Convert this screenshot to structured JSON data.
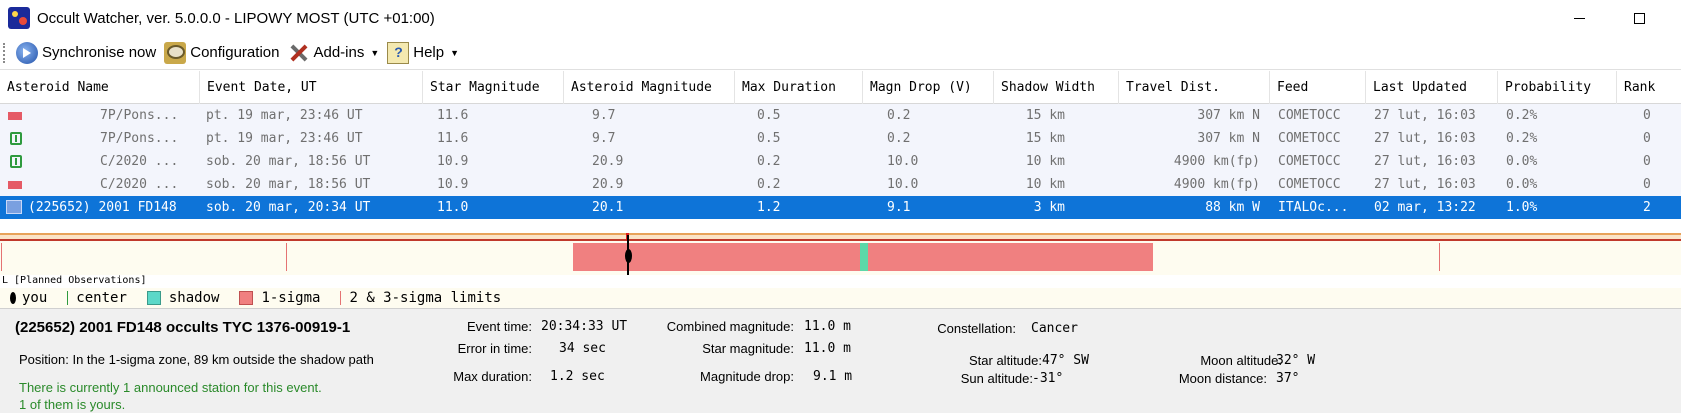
{
  "window": {
    "title": "Occult Watcher, ver. 5.0.0.0 - LIPOWY MOST (UTC +01:00)"
  },
  "toolbar": {
    "sync_label": "Synchronise now",
    "config_label": "Configuration",
    "addins_label": "Add-ins",
    "help_label": "Help"
  },
  "table": {
    "columns": [
      "Asteroid Name",
      "Event Date, UT",
      "Star Magnitude",
      "Asteroid Magnitude",
      "Max Duration",
      "Magn Drop (V)",
      "Shadow Width",
      "Travel Dist.",
      "Feed",
      "Last Updated",
      "Probability",
      "Rank"
    ],
    "rows": [
      {
        "icon": "flag-icon",
        "name": "7P/Pons...",
        "date": "pt. 19 mar, 23:46 UT",
        "star_mag": "11.6",
        "ast_mag": "9.7",
        "max_dur": "0.5",
        "magn_drop": "0.2",
        "shadow_width": "15 km",
        "travel": "307 km N",
        "feed": "COMETOCC",
        "updated": "27 lut, 16:03",
        "prob": "0.2%",
        "rank": "0"
      },
      {
        "icon": "station-icon",
        "name": "7P/Pons...",
        "date": "pt. 19 mar, 23:46 UT",
        "star_mag": "11.6",
        "ast_mag": "9.7",
        "max_dur": "0.5",
        "magn_drop": "0.2",
        "shadow_width": "15 km",
        "travel": "307 km N",
        "feed": "COMETOCC",
        "updated": "27 lut, 16:03",
        "prob": "0.2%",
        "rank": "0"
      },
      {
        "icon": "station-icon",
        "name": "C/2020 ...",
        "date": "sob. 20 mar, 18:56 UT",
        "star_mag": "10.9",
        "ast_mag": "20.9",
        "max_dur": "0.2",
        "magn_drop": "10.0",
        "shadow_width": "10 km",
        "travel": "4900 km(fp)",
        "feed": "COMETOCC",
        "updated": "27 lut, 16:03",
        "prob": "0.0%",
        "rank": "0"
      },
      {
        "icon": "flag-icon",
        "name": "C/2020 ...",
        "date": "sob. 20 mar, 18:56 UT",
        "star_mag": "10.9",
        "ast_mag": "20.9",
        "max_dur": "0.2",
        "magn_drop": "10.0",
        "shadow_width": "10 km",
        "travel": "4900 km(fp)",
        "feed": "COMETOCC",
        "updated": "27 lut, 16:03",
        "prob": "0.0%",
        "rank": "0"
      },
      {
        "icon": "selected-flag-icon",
        "name": "(225652) 2001 FD148",
        "date": "sob. 20 mar, 20:34 UT",
        "star_mag": "11.0",
        "ast_mag": "20.1",
        "max_dur": "1.2",
        "magn_drop": "9.1",
        "shadow_width": "3 km",
        "travel": "88 km W",
        "feed": "ITALOc...",
        "updated": "02 mar, 13:22",
        "prob": "1.0%",
        "rank": "2",
        "selected": true
      }
    ]
  },
  "path": {
    "legend_title": "L [Planned Observations]",
    "legend": {
      "you": "you",
      "center": "center",
      "shadow": "shadow",
      "sigma": "1-sigma",
      "limits": "2 & 3-sigma limits"
    }
  },
  "details": {
    "title": "(225652) 2001 FD148 occults TYC 1376-00919-1",
    "position": "Position:  In the 1-sigma zone, 89 km outside the shadow path",
    "stations_line1": "There is currently 1 announced station for this event.",
    "stations_line2": "1 of them is yours.",
    "event_time_label": "Event time:",
    "event_time": "20:34:33 UT",
    "error_time_label": "Error in time:",
    "error_time": "34 sec",
    "max_duration_label": "Max duration:",
    "max_duration": "1.2 sec",
    "combined_mag_label": "Combined magnitude:",
    "combined_mag": "11.0 m",
    "star_mag_label": "Star magnitude:",
    "star_mag": "11.0 m",
    "mag_drop_label": "Magnitude drop:",
    "mag_drop": "9.1 m",
    "constellation_label": "Constellation:",
    "constellation": "Cancer",
    "star_alt_label": "Star altitude:",
    "star_alt": "47° SW",
    "sun_alt_label": "Sun altitude:",
    "sun_alt": "-31°",
    "moon_alt_label": "Moon altitude:",
    "moon_alt": "32° W",
    "moon_dist_label": "Moon distance:",
    "moon_dist": "37°"
  },
  "colors": {
    "selection": "#0e74d8",
    "sigma": "#f08080",
    "shadow": "#5cd8a8",
    "station_text": "#2a8a2a"
  }
}
